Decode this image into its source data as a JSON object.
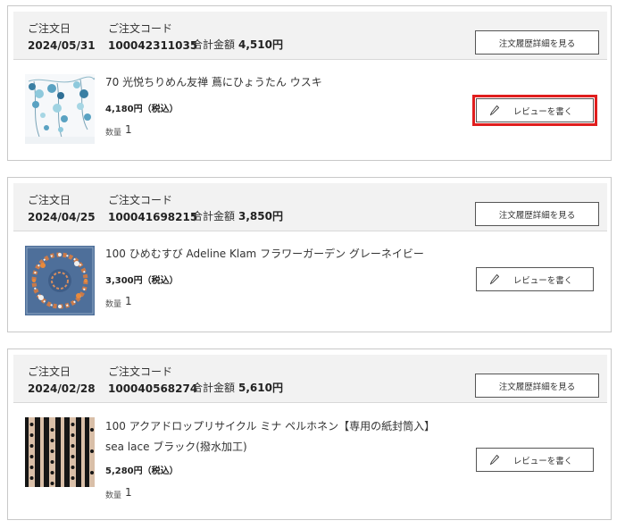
{
  "labels": {
    "order_date": "ご注文日",
    "order_code": "ご注文コード",
    "total": "合計金額",
    "detail_button": "注文履歴詳細を見る",
    "review_button": "レビューを書く",
    "quantity": "数量"
  },
  "orders": [
    {
      "date": "2024/05/31",
      "code": "100042311035",
      "total": "4,510円",
      "item": {
        "name": "70 光悦ちりめん友禅 蔦にひょうたん ウスキ",
        "price": "4,180円（税込）",
        "quantity": "1"
      }
    },
    {
      "date": "2024/04/25",
      "code": "100041698215",
      "total": "3,850円",
      "item": {
        "name": "100 ひめむすび Adeline Klam フラワーガーデン グレーネイビー",
        "price": "3,300円（税込）",
        "quantity": "1"
      }
    },
    {
      "date": "2024/02/28",
      "code": "100040568274",
      "total": "5,610円",
      "item": {
        "name": "100 アクアドロップリサイクル ミナ ペルホネン【専用の紙封筒入】sea lace ブラック(撥水加工)",
        "price": "5,280円（税込）",
        "quantity": "1"
      }
    }
  ],
  "colors": {
    "highlight": "#e01e1e",
    "header_bg": "#f2f2f2",
    "border": "#c8c8c8"
  },
  "icons": {
    "review": "pencil-icon"
  }
}
